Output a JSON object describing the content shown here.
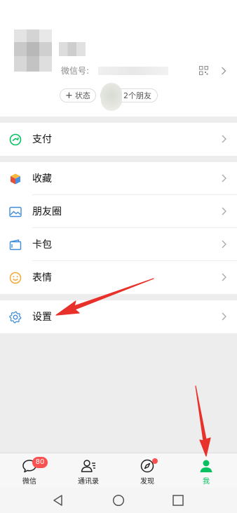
{
  "profile": {
    "wechat_id_label": "微信号:",
    "status_label": "状态",
    "friends_label": "2个朋友"
  },
  "menu": {
    "pay": "支付",
    "favorites": "收藏",
    "moments": "朋友圈",
    "cards": "卡包",
    "stickers": "表情",
    "settings": "设置"
  },
  "tabbar": {
    "tabs": [
      {
        "label": "微信",
        "icon": "chat-bubble-icon",
        "badge": "80"
      },
      {
        "label": "通讯录",
        "icon": "contacts-icon"
      },
      {
        "label": "发现",
        "icon": "compass-icon"
      },
      {
        "label": "我",
        "icon": "person-icon",
        "active": true
      }
    ]
  },
  "colors": {
    "accent": "#07c160",
    "badge": "#fa5151",
    "annotation_arrow": "#e8312a"
  }
}
